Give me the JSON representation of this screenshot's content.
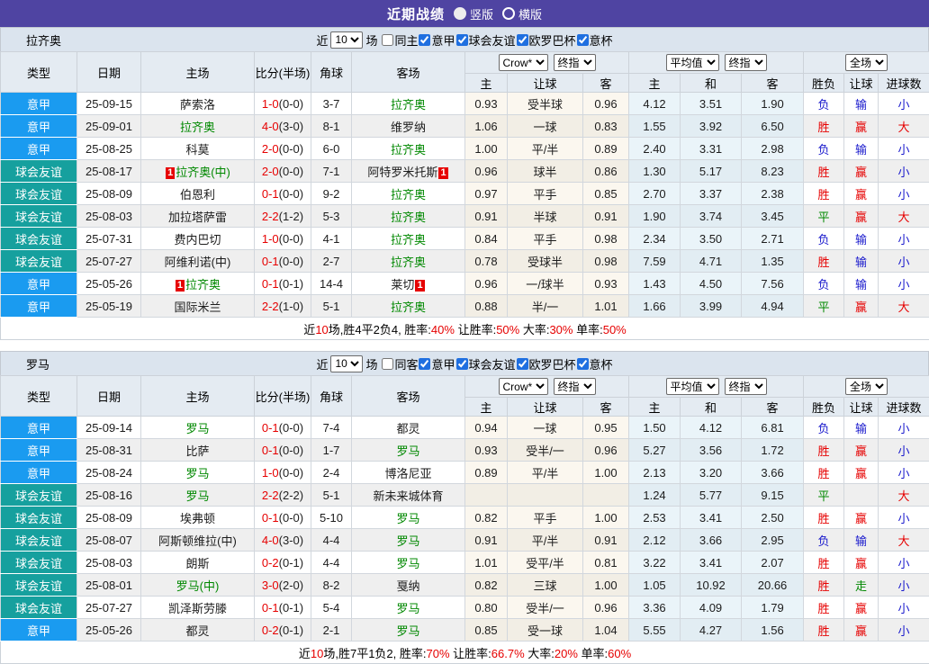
{
  "header": {
    "title": "近期战绩",
    "layout_options": [
      "竖版",
      "横版"
    ],
    "selected_layout": "竖版",
    "bar_color": "#4f44a2"
  },
  "controls": {
    "near_label": "近",
    "count_value": "10",
    "matches_label": "场",
    "odds_company": "Crow*",
    "odds_stage": "终指",
    "avg_type": "平均值",
    "avg_stage": "终指",
    "scope": "全场"
  },
  "columns": {
    "main": [
      "类型",
      "日期",
      "主场",
      "比分(半场)",
      "角球",
      "客场"
    ],
    "sub": [
      "主",
      "让球",
      "客",
      "主",
      "和",
      "客",
      "胜负",
      "让球",
      "进球数"
    ],
    "widths": [
      85,
      71,
      126,
      63,
      45,
      126,
      47,
      84,
      51,
      57,
      68,
      69,
      45,
      38,
      57
    ]
  },
  "league_colors": {
    "意甲": "#1a9bf0",
    "球会友谊": "#16a09e"
  },
  "result_colors": {
    "胜": "#e60000",
    "平": "#008800",
    "负": "#1818cc",
    "赢": "#e60000",
    "走": "#008800",
    "输": "#1818cc",
    "大": "#e60000",
    "小": "#1818cc"
  },
  "focus_color": "#008800",
  "score_color": "#e60000",
  "sections": [
    {
      "key": "lazio",
      "team": "拉齐奥",
      "same_venue_label": "同主",
      "same_venue_checked": false,
      "league_filters": [
        {
          "label": "意甲",
          "checked": true
        },
        {
          "label": "球会友谊",
          "checked": true
        },
        {
          "label": "欧罗巴杯",
          "checked": true
        },
        {
          "label": "意杯",
          "checked": true
        }
      ],
      "rows": [
        {
          "type": "意甲",
          "date": "25-09-15",
          "home": {
            "name": "萨索洛",
            "focus": false,
            "red": 0
          },
          "score_ft": "1-0",
          "score_ht": "(0-0)",
          "corner": "3-7",
          "away": {
            "name": "拉齐奥",
            "focus": true,
            "red": 0
          },
          "crow": [
            "0.93",
            "受半球",
            "0.96"
          ],
          "avg": [
            "4.12",
            "3.51",
            "1.90"
          ],
          "outcome": [
            "负",
            "输",
            "小"
          ]
        },
        {
          "type": "意甲",
          "date": "25-09-01",
          "home": {
            "name": "拉齐奥",
            "focus": true,
            "red": 0
          },
          "score_ft": "4-0",
          "score_ht": "(3-0)",
          "corner": "8-1",
          "away": {
            "name": "维罗纳",
            "focus": false,
            "red": 0
          },
          "crow": [
            "1.06",
            "一球",
            "0.83"
          ],
          "avg": [
            "1.55",
            "3.92",
            "6.50"
          ],
          "outcome": [
            "胜",
            "赢",
            "大"
          ]
        },
        {
          "type": "意甲",
          "date": "25-08-25",
          "home": {
            "name": "科莫",
            "focus": false,
            "red": 0
          },
          "score_ft": "2-0",
          "score_ht": "(0-0)",
          "corner": "6-0",
          "away": {
            "name": "拉齐奥",
            "focus": true,
            "red": 0
          },
          "crow": [
            "1.00",
            "平/半",
            "0.89"
          ],
          "avg": [
            "2.40",
            "3.31",
            "2.98"
          ],
          "outcome": [
            "负",
            "输",
            "小"
          ]
        },
        {
          "type": "球会友谊",
          "date": "25-08-17",
          "home": {
            "name": "拉齐奥(中)",
            "focus": true,
            "red": 1
          },
          "score_ft": "2-0",
          "score_ht": "(0-0)",
          "corner": "7-1",
          "away": {
            "name": "阿特罗米托斯",
            "focus": false,
            "red": 1
          },
          "crow": [
            "0.96",
            "球半",
            "0.86"
          ],
          "avg": [
            "1.30",
            "5.17",
            "8.23"
          ],
          "outcome": [
            "胜",
            "赢",
            "小"
          ]
        },
        {
          "type": "球会友谊",
          "date": "25-08-09",
          "home": {
            "name": "伯恩利",
            "focus": false,
            "red": 0
          },
          "score_ft": "0-1",
          "score_ht": "(0-0)",
          "corner": "9-2",
          "away": {
            "name": "拉齐奥",
            "focus": true,
            "red": 0
          },
          "crow": [
            "0.97",
            "平手",
            "0.85"
          ],
          "avg": [
            "2.70",
            "3.37",
            "2.38"
          ],
          "outcome": [
            "胜",
            "赢",
            "小"
          ]
        },
        {
          "type": "球会友谊",
          "date": "25-08-03",
          "home": {
            "name": "加拉塔萨雷",
            "focus": false,
            "red": 0
          },
          "score_ft": "2-2",
          "score_ht": "(1-2)",
          "corner": "5-3",
          "away": {
            "name": "拉齐奥",
            "focus": true,
            "red": 0
          },
          "crow": [
            "0.91",
            "半球",
            "0.91"
          ],
          "avg": [
            "1.90",
            "3.74",
            "3.45"
          ],
          "outcome": [
            "平",
            "赢",
            "大"
          ]
        },
        {
          "type": "球会友谊",
          "date": "25-07-31",
          "home": {
            "name": "费内巴切",
            "focus": false,
            "red": 0
          },
          "score_ft": "1-0",
          "score_ht": "(0-0)",
          "corner": "4-1",
          "away": {
            "name": "拉齐奥",
            "focus": true,
            "red": 0
          },
          "crow": [
            "0.84",
            "平手",
            "0.98"
          ],
          "avg": [
            "2.34",
            "3.50",
            "2.71"
          ],
          "outcome": [
            "负",
            "输",
            "小"
          ]
        },
        {
          "type": "球会友谊",
          "date": "25-07-27",
          "home": {
            "name": "阿维利诺(中)",
            "focus": false,
            "red": 0
          },
          "score_ft": "0-1",
          "score_ht": "(0-0)",
          "corner": "2-7",
          "away": {
            "name": "拉齐奥",
            "focus": true,
            "red": 0
          },
          "crow": [
            "0.78",
            "受球半",
            "0.98"
          ],
          "avg": [
            "7.59",
            "4.71",
            "1.35"
          ],
          "outcome": [
            "胜",
            "输",
            "小"
          ]
        },
        {
          "type": "意甲",
          "date": "25-05-26",
          "home": {
            "name": "拉齐奥",
            "focus": true,
            "red": 1
          },
          "score_ft": "0-1",
          "score_ht": "(0-1)",
          "corner": "14-4",
          "away": {
            "name": "莱切",
            "focus": false,
            "red": 1
          },
          "crow": [
            "0.96",
            "一/球半",
            "0.93"
          ],
          "avg": [
            "1.43",
            "4.50",
            "7.56"
          ],
          "outcome": [
            "负",
            "输",
            "小"
          ]
        },
        {
          "type": "意甲",
          "date": "25-05-19",
          "home": {
            "name": "国际米兰",
            "focus": false,
            "red": 0
          },
          "score_ft": "2-2",
          "score_ht": "(1-0)",
          "corner": "5-1",
          "away": {
            "name": "拉齐奥",
            "focus": true,
            "red": 0
          },
          "crow": [
            "0.88",
            "半/一",
            "1.01"
          ],
          "avg": [
            "1.66",
            "3.99",
            "4.94"
          ],
          "outcome": [
            "平",
            "赢",
            "大"
          ]
        }
      ],
      "summary": [
        {
          "text": "近",
          "red": false
        },
        {
          "text": "10",
          "red": true
        },
        {
          "text": "场,胜4平2负4, 胜率:",
          "red": false
        },
        {
          "text": "40%",
          "red": true
        },
        {
          "text": " 让胜率:",
          "red": false
        },
        {
          "text": "50%",
          "red": true
        },
        {
          "text": " 大率:",
          "red": false
        },
        {
          "text": "30%",
          "red": true
        },
        {
          "text": " 单率:",
          "red": false
        },
        {
          "text": "50%",
          "red": true
        }
      ]
    },
    {
      "key": "roma",
      "team": "罗马",
      "same_venue_label": "同客",
      "same_venue_checked": false,
      "league_filters": [
        {
          "label": "意甲",
          "checked": true
        },
        {
          "label": "球会友谊",
          "checked": true
        },
        {
          "label": "欧罗巴杯",
          "checked": true
        },
        {
          "label": "意杯",
          "checked": true
        }
      ],
      "rows": [
        {
          "type": "意甲",
          "date": "25-09-14",
          "home": {
            "name": "罗马",
            "focus": true,
            "red": 0
          },
          "score_ft": "0-1",
          "score_ht": "(0-0)",
          "corner": "7-4",
          "away": {
            "name": "都灵",
            "focus": false,
            "red": 0
          },
          "crow": [
            "0.94",
            "一球",
            "0.95"
          ],
          "avg": [
            "1.50",
            "4.12",
            "6.81"
          ],
          "outcome": [
            "负",
            "输",
            "小"
          ]
        },
        {
          "type": "意甲",
          "date": "25-08-31",
          "home": {
            "name": "比萨",
            "focus": false,
            "red": 0
          },
          "score_ft": "0-1",
          "score_ht": "(0-0)",
          "corner": "1-7",
          "away": {
            "name": "罗马",
            "focus": true,
            "red": 0
          },
          "crow": [
            "0.93",
            "受半/一",
            "0.96"
          ],
          "avg": [
            "5.27",
            "3.56",
            "1.72"
          ],
          "outcome": [
            "胜",
            "赢",
            "小"
          ]
        },
        {
          "type": "意甲",
          "date": "25-08-24",
          "home": {
            "name": "罗马",
            "focus": true,
            "red": 0
          },
          "score_ft": "1-0",
          "score_ht": "(0-0)",
          "corner": "2-4",
          "away": {
            "name": "博洛尼亚",
            "focus": false,
            "red": 0
          },
          "crow": [
            "0.89",
            "平/半",
            "1.00"
          ],
          "avg": [
            "2.13",
            "3.20",
            "3.66"
          ],
          "outcome": [
            "胜",
            "赢",
            "小"
          ]
        },
        {
          "type": "球会友谊",
          "date": "25-08-16",
          "home": {
            "name": "罗马",
            "focus": true,
            "red": 0
          },
          "score_ft": "2-2",
          "score_ht": "(2-2)",
          "corner": "5-1",
          "away": {
            "name": "新未来城体育",
            "focus": false,
            "red": 0
          },
          "crow": [
            "",
            "",
            ""
          ],
          "avg": [
            "1.24",
            "5.77",
            "9.15"
          ],
          "outcome": [
            "平",
            "",
            "大"
          ]
        },
        {
          "type": "球会友谊",
          "date": "25-08-09",
          "home": {
            "name": "埃弗顿",
            "focus": false,
            "red": 0
          },
          "score_ft": "0-1",
          "score_ht": "(0-0)",
          "corner": "5-10",
          "away": {
            "name": "罗马",
            "focus": true,
            "red": 0
          },
          "crow": [
            "0.82",
            "平手",
            "1.00"
          ],
          "avg": [
            "2.53",
            "3.41",
            "2.50"
          ],
          "outcome": [
            "胜",
            "赢",
            "小"
          ]
        },
        {
          "type": "球会友谊",
          "date": "25-08-07",
          "home": {
            "name": "阿斯顿维拉(中)",
            "focus": false,
            "red": 0
          },
          "score_ft": "4-0",
          "score_ht": "(3-0)",
          "corner": "4-4",
          "away": {
            "name": "罗马",
            "focus": true,
            "red": 0
          },
          "crow": [
            "0.91",
            "平/半",
            "0.91"
          ],
          "avg": [
            "2.12",
            "3.66",
            "2.95"
          ],
          "outcome": [
            "负",
            "输",
            "大"
          ]
        },
        {
          "type": "球会友谊",
          "date": "25-08-03",
          "home": {
            "name": "朗斯",
            "focus": false,
            "red": 0
          },
          "score_ft": "0-2",
          "score_ht": "(0-1)",
          "corner": "4-4",
          "away": {
            "name": "罗马",
            "focus": true,
            "red": 0
          },
          "crow": [
            "1.01",
            "受平/半",
            "0.81"
          ],
          "avg": [
            "3.22",
            "3.41",
            "2.07"
          ],
          "outcome": [
            "胜",
            "赢",
            "小"
          ]
        },
        {
          "type": "球会友谊",
          "date": "25-08-01",
          "home": {
            "name": "罗马(中)",
            "focus": true,
            "red": 0
          },
          "score_ft": "3-0",
          "score_ht": "(2-0)",
          "corner": "8-2",
          "away": {
            "name": "戛纳",
            "focus": false,
            "red": 0
          },
          "crow": [
            "0.82",
            "三球",
            "1.00"
          ],
          "avg": [
            "1.05",
            "10.92",
            "20.66"
          ],
          "outcome": [
            "胜",
            "走",
            "小"
          ]
        },
        {
          "type": "球会友谊",
          "date": "25-07-27",
          "home": {
            "name": "凯泽斯劳滕",
            "focus": false,
            "red": 0
          },
          "score_ft": "0-1",
          "score_ht": "(0-1)",
          "corner": "5-4",
          "away": {
            "name": "罗马",
            "focus": true,
            "red": 0
          },
          "crow": [
            "0.80",
            "受半/一",
            "0.96"
          ],
          "avg": [
            "3.36",
            "4.09",
            "1.79"
          ],
          "outcome": [
            "胜",
            "赢",
            "小"
          ]
        },
        {
          "type": "意甲",
          "date": "25-05-26",
          "home": {
            "name": "都灵",
            "focus": false,
            "red": 0
          },
          "score_ft": "0-2",
          "score_ht": "(0-1)",
          "corner": "2-1",
          "away": {
            "name": "罗马",
            "focus": true,
            "red": 0
          },
          "crow": [
            "0.85",
            "受一球",
            "1.04"
          ],
          "avg": [
            "5.55",
            "4.27",
            "1.56"
          ],
          "outcome": [
            "胜",
            "赢",
            "小"
          ]
        }
      ],
      "summary": [
        {
          "text": "近",
          "red": false
        },
        {
          "text": "10",
          "red": true
        },
        {
          "text": "场,胜7平1负2, 胜率:",
          "red": false
        },
        {
          "text": "70%",
          "red": true
        },
        {
          "text": " 让胜率:",
          "red": false
        },
        {
          "text": "66.7%",
          "red": true
        },
        {
          "text": " 大率:",
          "red": false
        },
        {
          "text": "20%",
          "red": true
        },
        {
          "text": " 单率:",
          "red": false
        },
        {
          "text": "60%",
          "red": true
        }
      ]
    }
  ]
}
